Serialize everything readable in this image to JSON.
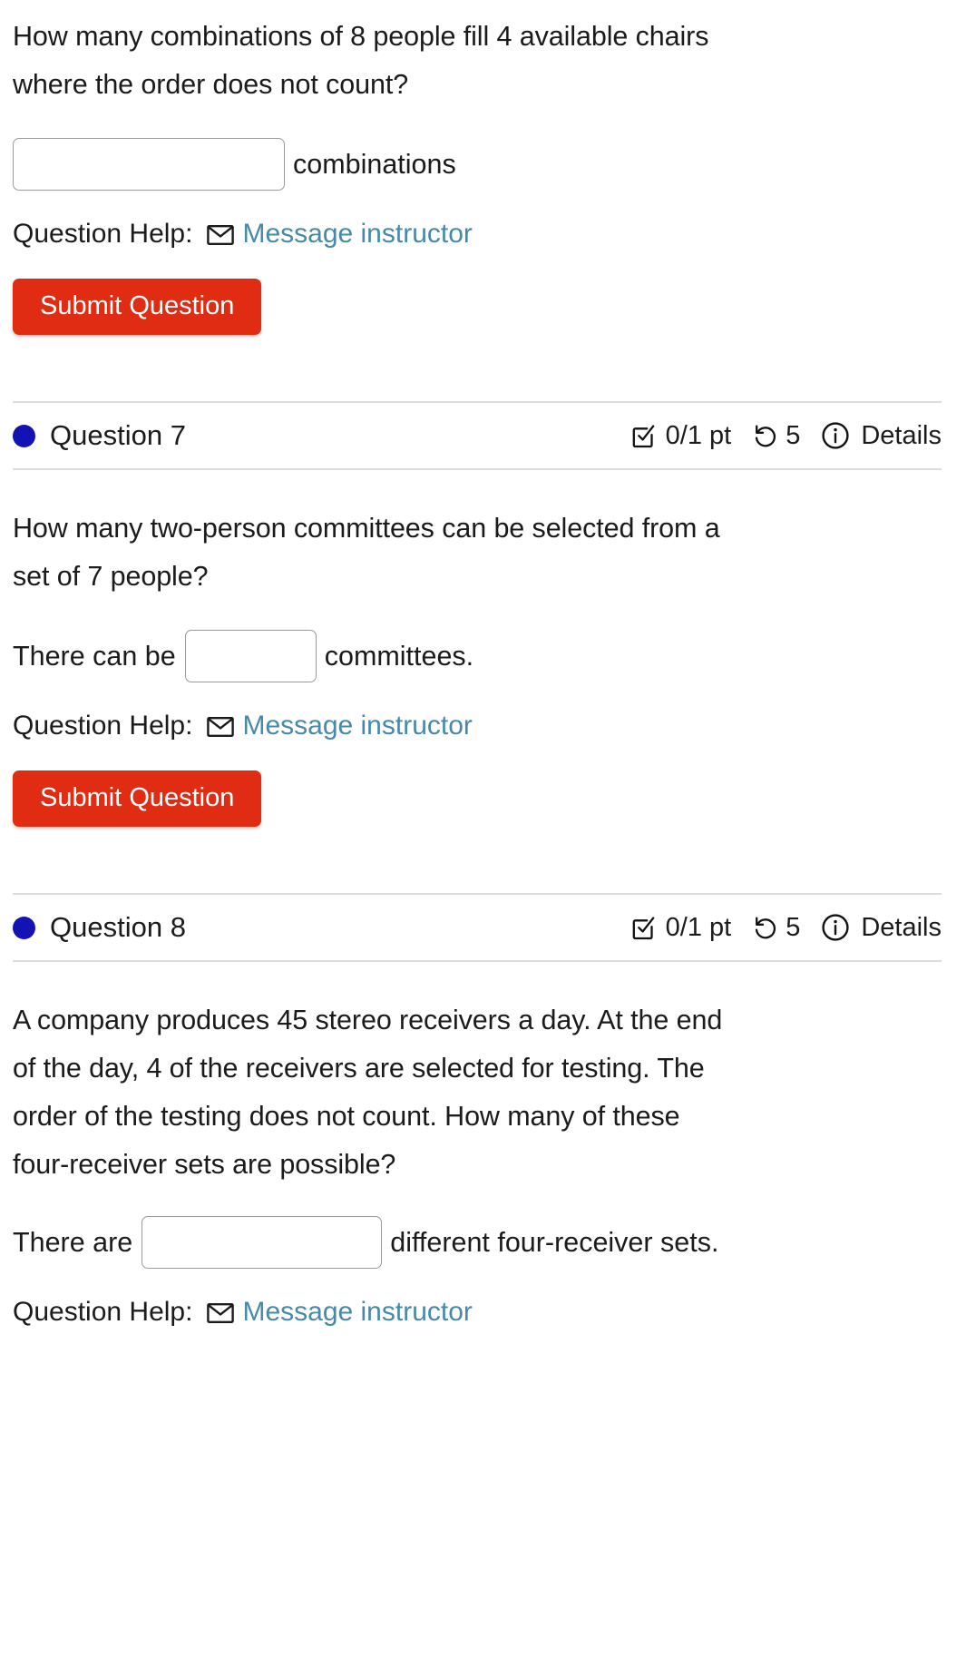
{
  "page": {
    "background": "#ffffff",
    "link_color": "#4789a8",
    "button_color": "#e12c14",
    "bullet_color": "#1312b4",
    "divider_color": "#dcdcdc"
  },
  "question6": {
    "body_line1": "How many combinations of 8 people fill 4 available chairs",
    "body_line2": "where the order does not count?",
    "answer": {
      "value": "",
      "placeholder": "",
      "unit_label": "combinations"
    },
    "help": {
      "label": "Question Help:",
      "icon": "envelope-icon",
      "link_text": "Message instructor"
    },
    "submit_label": "Submit Question"
  },
  "question7": {
    "header": {
      "bullet": "status-dot",
      "title": "Question 7",
      "points_icon": "check-square-icon",
      "points": "0/1 pt",
      "attempts_icon": "rotate-left-icon",
      "attempts": "5",
      "details_icon": "info-circle-icon",
      "details_label": "Details"
    },
    "body_line1": "How many two-person committees can be selected from a",
    "body_line2": "set of 7 people?",
    "answer": {
      "lead_text": "There can be",
      "value": "",
      "placeholder": "",
      "trail_text": "committees."
    },
    "help": {
      "label": "Question Help:",
      "icon": "envelope-icon",
      "link_text": "Message instructor"
    },
    "submit_label": "Submit Question"
  },
  "question8": {
    "header": {
      "bullet": "status-dot",
      "title": "Question 8",
      "points_icon": "check-square-icon",
      "points": "0/1 pt",
      "attempts_icon": "rotate-left-icon",
      "attempts": "5",
      "details_icon": "info-circle-icon",
      "details_label": "Details"
    },
    "body_line1": "A company produces 45 stereo receivers a day. At the end",
    "body_line2": "of the day, 4 of the receivers are selected for testing. The",
    "body_line3": "order of the testing does not count. How many of these",
    "body_line4": "four-receiver sets are possible?",
    "answer": {
      "lead_text": "There are",
      "value": "",
      "placeholder": "",
      "trail_text": "different four-receiver sets."
    },
    "help": {
      "label": "Question Help:",
      "icon": "envelope-icon",
      "link_text": "Message instructor"
    }
  }
}
